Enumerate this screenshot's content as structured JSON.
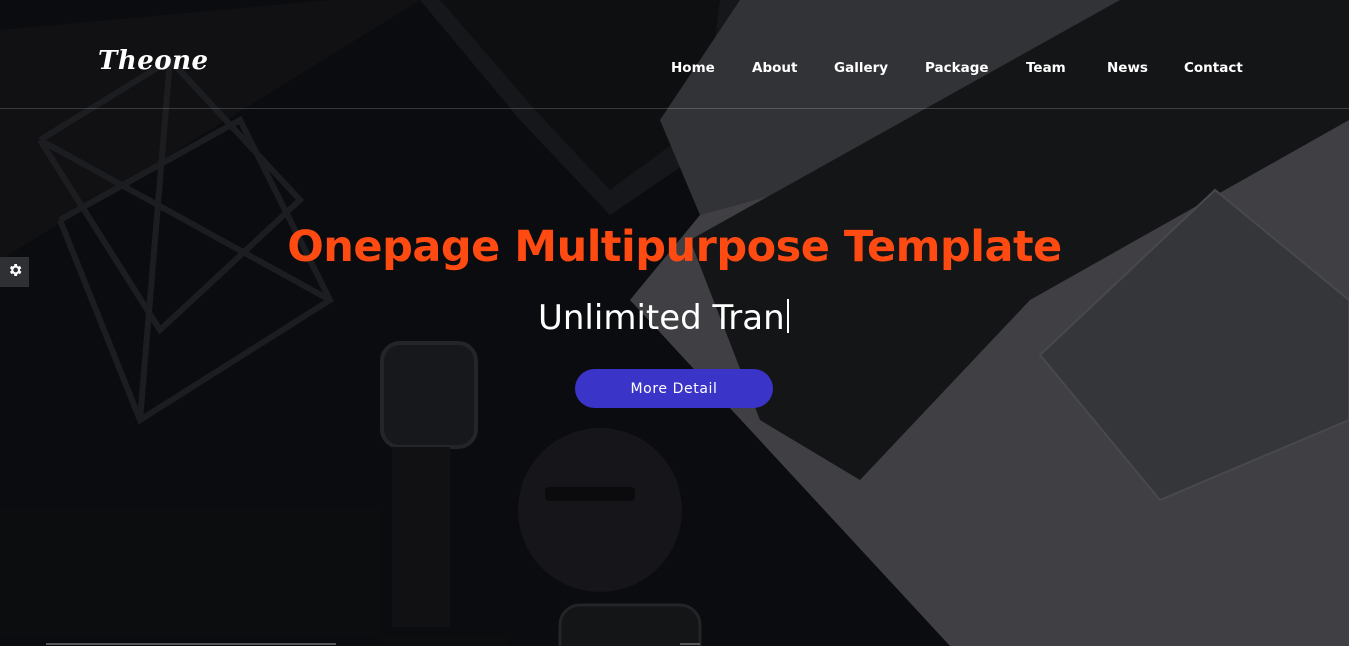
{
  "brand": {
    "logo_text": "Theone"
  },
  "nav": {
    "items": [
      {
        "label": "Home"
      },
      {
        "label": "About"
      },
      {
        "label": "Gallery"
      },
      {
        "label": "Package"
      },
      {
        "label": "Team"
      },
      {
        "label": "News"
      },
      {
        "label": "Contact"
      }
    ]
  },
  "hero": {
    "headline": "Onepage Multipurpose Template",
    "typed_text": "Unlimited Tran",
    "cta_label": "More Detail"
  },
  "widgets": {
    "settings_icon": "gear-icon"
  },
  "colors": {
    "accent": "#ff4a12",
    "button": "#3a35c8",
    "text": "#ffffff"
  }
}
